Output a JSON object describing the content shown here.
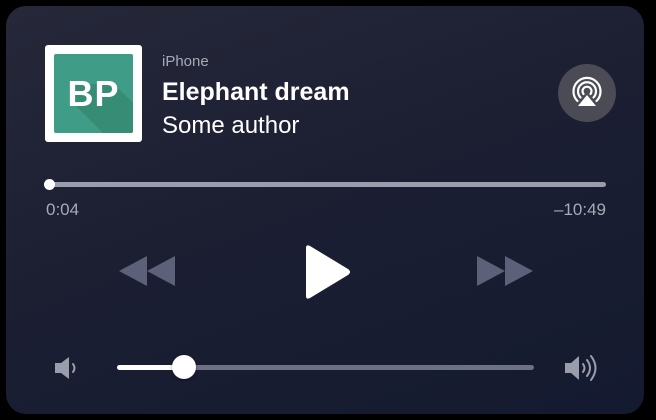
{
  "player": {
    "source_label": "iPhone",
    "title": "Elephant dream",
    "author": "Some author",
    "artwork_text": "BP",
    "artwork_color": "#3f9c86",
    "progress": {
      "elapsed": "0:04",
      "remaining": "–10:49",
      "fraction": 0.006
    },
    "volume": {
      "fraction": 0.16
    }
  },
  "icons": {
    "airplay": "airplay-icon",
    "rewind": "rewind-icon",
    "play": "play-icon",
    "fast_forward": "fast-forward-icon",
    "volume_low": "volume-low-icon",
    "volume_high": "volume-high-icon"
  },
  "colors": {
    "background": "#1c1f32",
    "text_primary": "#ffffff",
    "text_secondary": "#a7a9b6",
    "control_dimmed": "#5d6079"
  }
}
